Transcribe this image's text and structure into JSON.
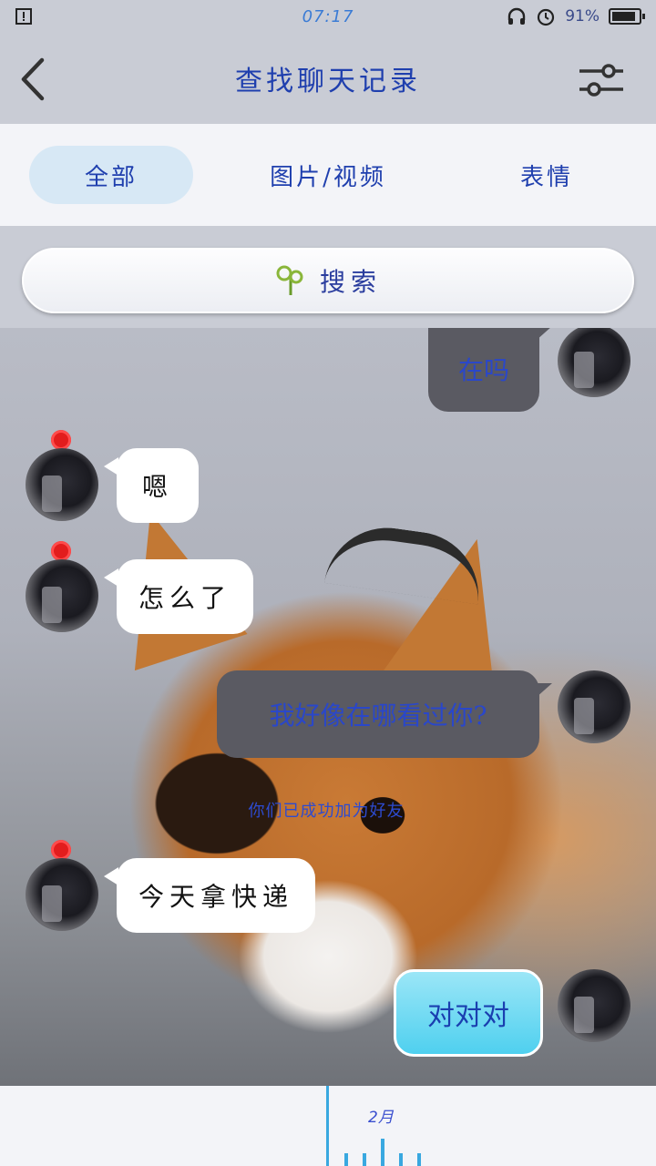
{
  "status_bar": {
    "time": "07:17",
    "battery": "91%",
    "battery_level": 0.91
  },
  "header": {
    "title": "查找聊天记录"
  },
  "tabs": [
    {
      "label": "全部",
      "active": true
    },
    {
      "label": "图片/视频",
      "active": false
    },
    {
      "label": "表情",
      "active": false
    }
  ],
  "search": {
    "label": "搜索"
  },
  "messages": [
    {
      "side": "out",
      "text": "在吗"
    },
    {
      "side": "in",
      "text": "嗯"
    },
    {
      "side": "in",
      "text": "怎么了"
    },
    {
      "side": "out",
      "text": "我好像在哪看过你?"
    },
    {
      "side": "system",
      "text": "你们已成功加为好友"
    },
    {
      "side": "in",
      "text": "今天拿快递"
    },
    {
      "side": "out",
      "text": "对对对"
    }
  ],
  "timeline": {
    "month": "2月"
  },
  "colors": {
    "accent": "#39a8e0",
    "header_bg": "#c9ccd5",
    "tab_active": "#d7e8f5"
  }
}
